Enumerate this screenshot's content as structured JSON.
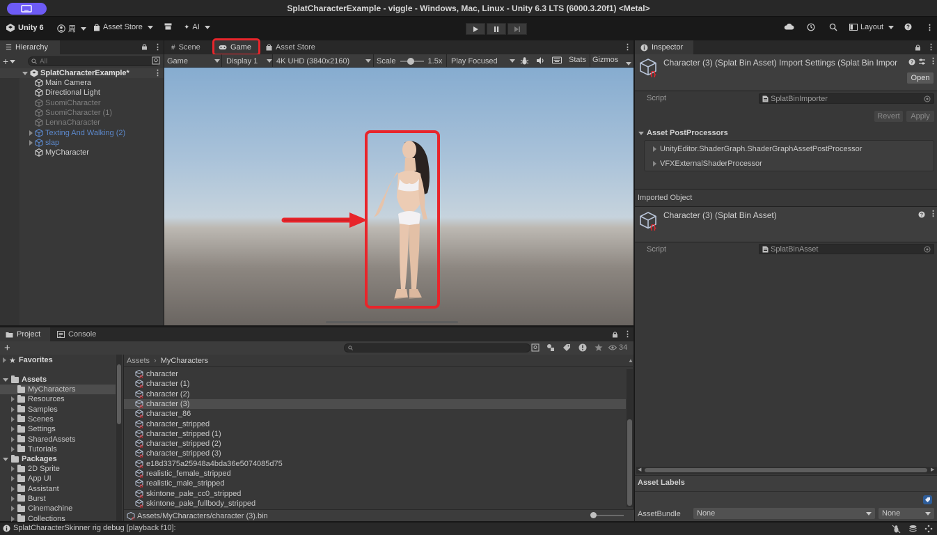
{
  "window": {
    "title": "SplatCharacterExample - viggle - Windows, Mac, Linux - Unity 6.3 LTS (6000.3.20f1) <Metal>"
  },
  "toolbar": {
    "unity_label": "Unity 6",
    "account_label": "周",
    "asset_store_label": "Asset Store",
    "ai_label": "AI",
    "layout_label": "Layout"
  },
  "hierarchy": {
    "tab": "Hierarchy",
    "search_placeholder": "All",
    "scene_name": "SplatCharacterExample*",
    "items": [
      {
        "label": "Main Camera",
        "state": "normal"
      },
      {
        "label": "Directional Light",
        "state": "normal"
      },
      {
        "label": "SuomiCharacter",
        "state": "disabled"
      },
      {
        "label": "SuomiCharacter (1)",
        "state": "disabled"
      },
      {
        "label": "LennaCharacter",
        "state": "disabled"
      },
      {
        "label": "Texting And Walking (2)",
        "state": "prefab-disabled"
      },
      {
        "label": "slap",
        "state": "prefab-disabled"
      },
      {
        "label": "MyCharacter",
        "state": "normal"
      }
    ]
  },
  "game_tabs": {
    "scene": "Scene",
    "game": "Game",
    "asset_store": "Asset Store"
  },
  "game_toolbar": {
    "view": "Game",
    "display": "Display 1",
    "resolution": "4K UHD (3840x2160)",
    "scale_label": "Scale",
    "scale_value": "1.5x",
    "play_mode": "Play Focused",
    "stats": "Stats",
    "gizmos": "Gizmos"
  },
  "project": {
    "tab_project": "Project",
    "tab_console": "Console",
    "count": "34",
    "favorites": "Favorites",
    "assets_root": "Assets",
    "asset_folders": [
      "MyCharacters",
      "Resources",
      "Samples",
      "Scenes",
      "Settings",
      "SharedAssets",
      "Tutorials"
    ],
    "packages_root": "Packages",
    "package_folders": [
      "2D Sprite",
      "App UI",
      "Assistant",
      "Burst",
      "Cinemachine",
      "Collections"
    ],
    "breadcrumb": [
      "Assets",
      "MyCharacters"
    ],
    "files": [
      "character",
      "character (1)",
      "character (2)",
      "character (3)",
      "character_86",
      "character_stripped",
      "character_stripped (1)",
      "character_stripped (2)",
      "character_stripped (3)",
      "e18d3375a25948a4bda36e5074085d75",
      "realistic_female_stripped",
      "realistic_male_stripped",
      "skintone_pale_cc0_stripped",
      "skintone_pale_fullbody_stripped"
    ],
    "selected_file": "character (3)",
    "path": "Assets/MyCharacters/character (3).bin"
  },
  "inspector": {
    "tab": "Inspector",
    "header_title": "Character (3) (Splat Bin Asset) Import Settings (Splat Bin Impor",
    "open_button": "Open",
    "script_label": "Script",
    "script_value": "SplatBinImporter",
    "revert_button": "Revert",
    "apply_button": "Apply",
    "postprocessors_title": "Asset PostProcessors",
    "postprocessors": [
      "UnityEditor.ShaderGraph.ShaderGraphAssetPostProcessor",
      "VFXExternalShaderProcessor"
    ],
    "imported_object_label": "Imported Object",
    "imported_title": "Character (3) (Splat Bin Asset)",
    "imported_script_label": "Script",
    "imported_script_value": "SplatBinAsset",
    "asset_labels": "Asset Labels",
    "assetbundle_label": "AssetBundle",
    "assetbundle_value": "None",
    "assetbundle_variant": "None"
  },
  "statusbar": {
    "message": "SplatCharacterSkinner rig debug [playback f10]:"
  },
  "colors": {
    "accent_purple": "#6d5bf5",
    "highlight_red": "#e8252b",
    "selection": "#4d4d4d",
    "disabled_text": "#7f7f7f",
    "prefab_blue": "#5b87c9"
  }
}
